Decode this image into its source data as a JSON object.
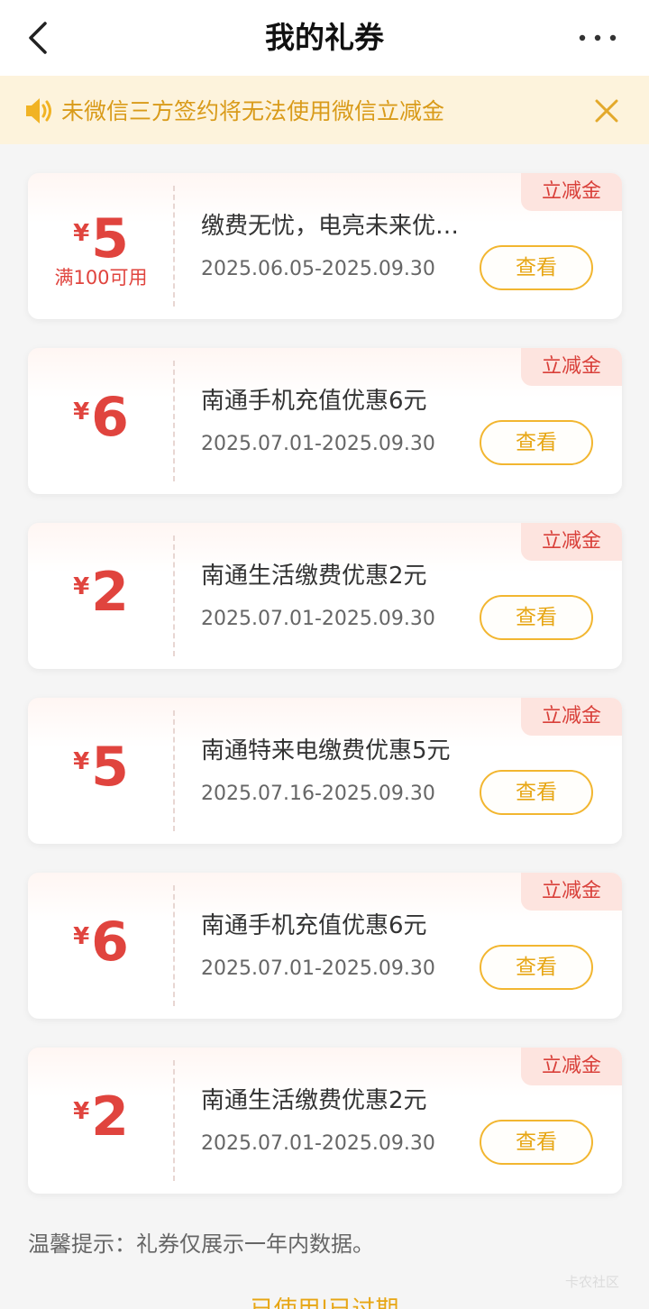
{
  "header": {
    "title": "我的礼券"
  },
  "notice": {
    "text": "未微信三方签约将无法使用微信立减金"
  },
  "coupons": [
    {
      "currency": "¥",
      "value": "5",
      "condition": "满100可用",
      "tag": "立减金",
      "title": "缴费无忧，电亮未来优…",
      "date": "2025.06.05-2025.09.30",
      "button": "查看"
    },
    {
      "currency": "¥",
      "value": "6",
      "condition": "",
      "tag": "立减金",
      "title": "南通手机充值优惠6元",
      "date": "2025.07.01-2025.09.30",
      "button": "查看"
    },
    {
      "currency": "¥",
      "value": "2",
      "condition": "",
      "tag": "立减金",
      "title": "南通生活缴费优惠2元",
      "date": "2025.07.01-2025.09.30",
      "button": "查看"
    },
    {
      "currency": "¥",
      "value": "5",
      "condition": "",
      "tag": "立减金",
      "title": "南通特来电缴费优惠5元",
      "date": "2025.07.16-2025.09.30",
      "button": "查看"
    },
    {
      "currency": "¥",
      "value": "6",
      "condition": "",
      "tag": "立减金",
      "title": "南通手机充值优惠6元",
      "date": "2025.07.01-2025.09.30",
      "button": "查看"
    },
    {
      "currency": "¥",
      "value": "2",
      "condition": "",
      "tag": "立减金",
      "title": "南通生活缴费优惠2元",
      "date": "2025.07.01-2025.09.30",
      "button": "查看"
    }
  ],
  "footer": {
    "tip": "温馨提示：礼券仅展示一年内数据。",
    "used_link": "已使用",
    "separator": "|",
    "expired_link": "已过期",
    "watermark": "卡农社区"
  },
  "colors": {
    "accent_red": "#e0443e",
    "accent_gold": "#e7a614",
    "notice_bg": "#fdf3dc"
  }
}
